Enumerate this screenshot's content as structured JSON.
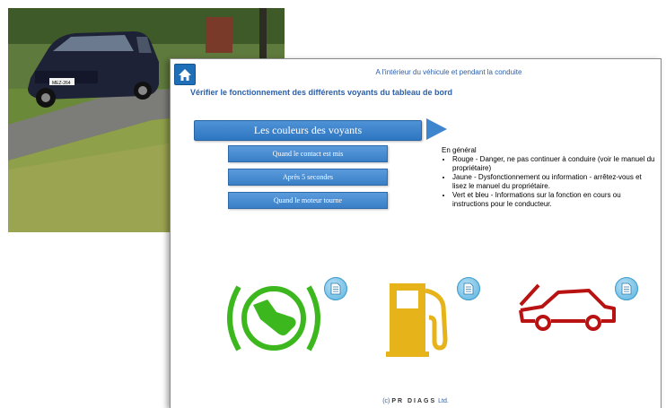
{
  "header": {
    "title": "A l'intérieur du véhicule et pendant la conduite",
    "subtitle": "Vérifier le fonctionnement des différents voyants du tableau de bord"
  },
  "main_button": {
    "label": "Les couleurs des voyants"
  },
  "sub_buttons": [
    {
      "label": "Quand le contact est mis"
    },
    {
      "label": "Après 5 secondes"
    },
    {
      "label": "Quand le moteur tourne"
    }
  ],
  "info": {
    "heading": "En général",
    "items": [
      "Rouge - Danger, ne pas continuer à conduire (voir le manuel du propriétaire)",
      "Jaune - Dysfonctionnement ou information - arrêtez-vous et lisez le manuel du propriétaire.",
      "Vert et bleu - Informations sur la fonction en cours ou instructions pour le conducteur."
    ]
  },
  "photo": {
    "plate": "MEZ-264"
  },
  "indicators": [
    {
      "name": "brake-pedal-indicator",
      "color": "#3cb81e"
    },
    {
      "name": "fuel-indicator",
      "color": "#e6b41a"
    },
    {
      "name": "hood-open-indicator",
      "color": "#b81212"
    }
  ],
  "footer": {
    "prefix": "(c)",
    "brand": "PR DIAGS",
    "suffix": "Ltd."
  },
  "colors": {
    "accent": "#2e76c2",
    "title": "#2b5fa8"
  }
}
